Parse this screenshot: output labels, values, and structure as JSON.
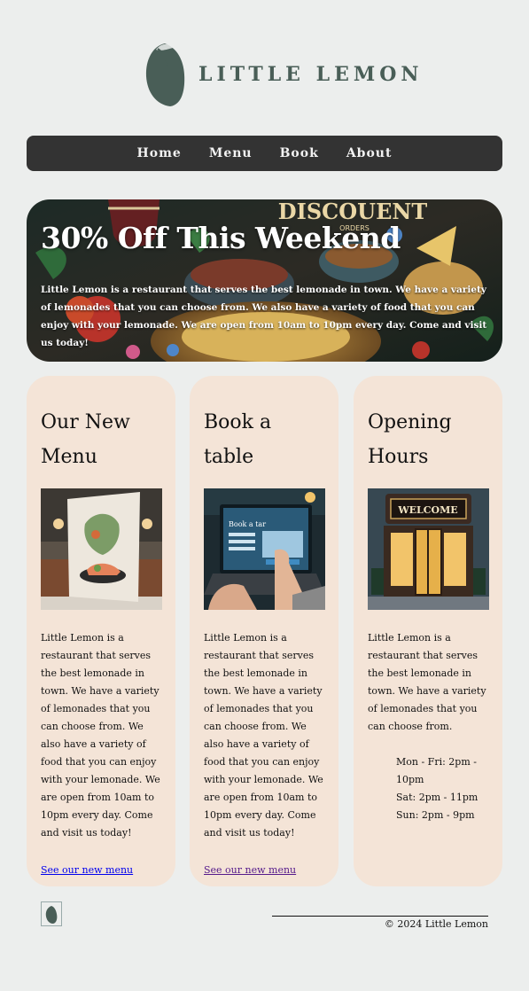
{
  "brand": {
    "name": "LITTLE LEMON",
    "logo_icon": "lemon-icon",
    "color": "#495e57"
  },
  "nav": {
    "items": [
      {
        "label": "Home"
      },
      {
        "label": "Menu"
      },
      {
        "label": "Book"
      },
      {
        "label": "About"
      }
    ]
  },
  "hero": {
    "title": "30% Off This Weekend",
    "text": "Little Lemon is a restaurant that serves the best lemonade in town. We have a variety of lemonades that you can choose from. We also have a variety of food that you can enjoy with your lemonade. We are open from 10am to 10pm every day. Come and visit us today!",
    "image_overlay_text": "DISCOUENT",
    "image_overlay_subtext": "ORDERS"
  },
  "cards": [
    {
      "title": "Our New Menu",
      "image_icon": "menu-image",
      "text": "Little Lemon is a restaurant that serves the best lemonade in town. We have a variety of lemonades that you can choose from. We also have a variety of food that you can enjoy with your lemonade. We are open from 10am to 10pm every day. Come and visit us today!",
      "link": "See our new menu"
    },
    {
      "title": "Book a table",
      "image_icon": "booking-image",
      "image_caption": "Book a tar",
      "text": "Little Lemon is a restaurant that serves the best lemonade in town. We have a variety of lemonades that you can choose from. We also have a variety of food that you can enjoy with your lemonade. We are open from 10am to 10pm every day. Come and visit us today!",
      "link": "See our new menu"
    },
    {
      "title": "Opening Hours",
      "image_icon": "storefront-image",
      "image_sign": "WELCOME",
      "text": "Little Lemon is a restaurant that serves the best lemonade in town. We have a variety of lemonades that you can choose from.",
      "hours": [
        "Mon - Fri: 2pm - 10pm",
        "Sat: 2pm - 11pm",
        "Sun: 2pm - 9pm"
      ]
    }
  ],
  "footer": {
    "copyright": "© 2024 Little Lemon"
  },
  "colors": {
    "background": "#eceeed",
    "nav": "#333333",
    "card": "#f4e4d7",
    "link": "#0000ee",
    "link_visited": "#551a8b"
  }
}
